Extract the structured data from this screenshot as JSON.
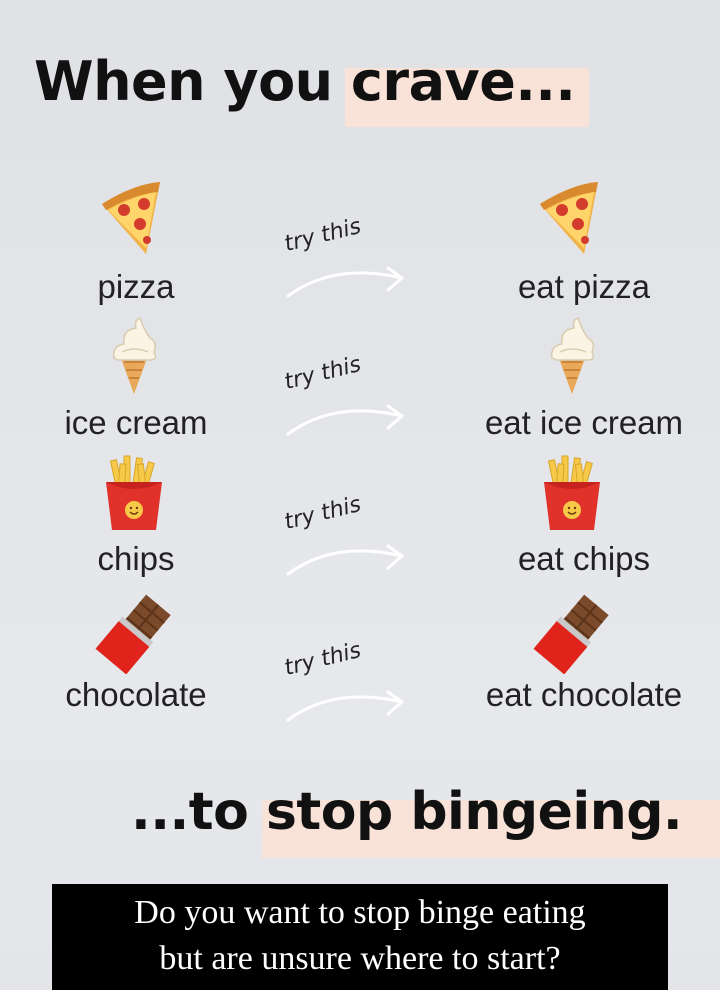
{
  "title": {
    "prefix": "When you ",
    "highlight": "crave..."
  },
  "try_label": "try this",
  "rows": [
    {
      "icon": "pizza-icon",
      "left": "pizza",
      "right": "eat pizza"
    },
    {
      "icon": "ice-cream-icon",
      "left": "ice cream",
      "right": "eat ice cream"
    },
    {
      "icon": "fries-icon",
      "left": "chips",
      "right": "eat chips"
    },
    {
      "icon": "chocolate-icon",
      "left": "chocolate",
      "right": "eat chocolate"
    }
  ],
  "bottom": {
    "prefix": "...to ",
    "highlight": "stop bingeing."
  },
  "cta": {
    "line1": "Do you want to stop binge eating",
    "line2": "but are unsure where to start?"
  },
  "colors": {
    "highlight": "#f9e2d8",
    "text": "#111111",
    "cta_bg": "#000000"
  }
}
